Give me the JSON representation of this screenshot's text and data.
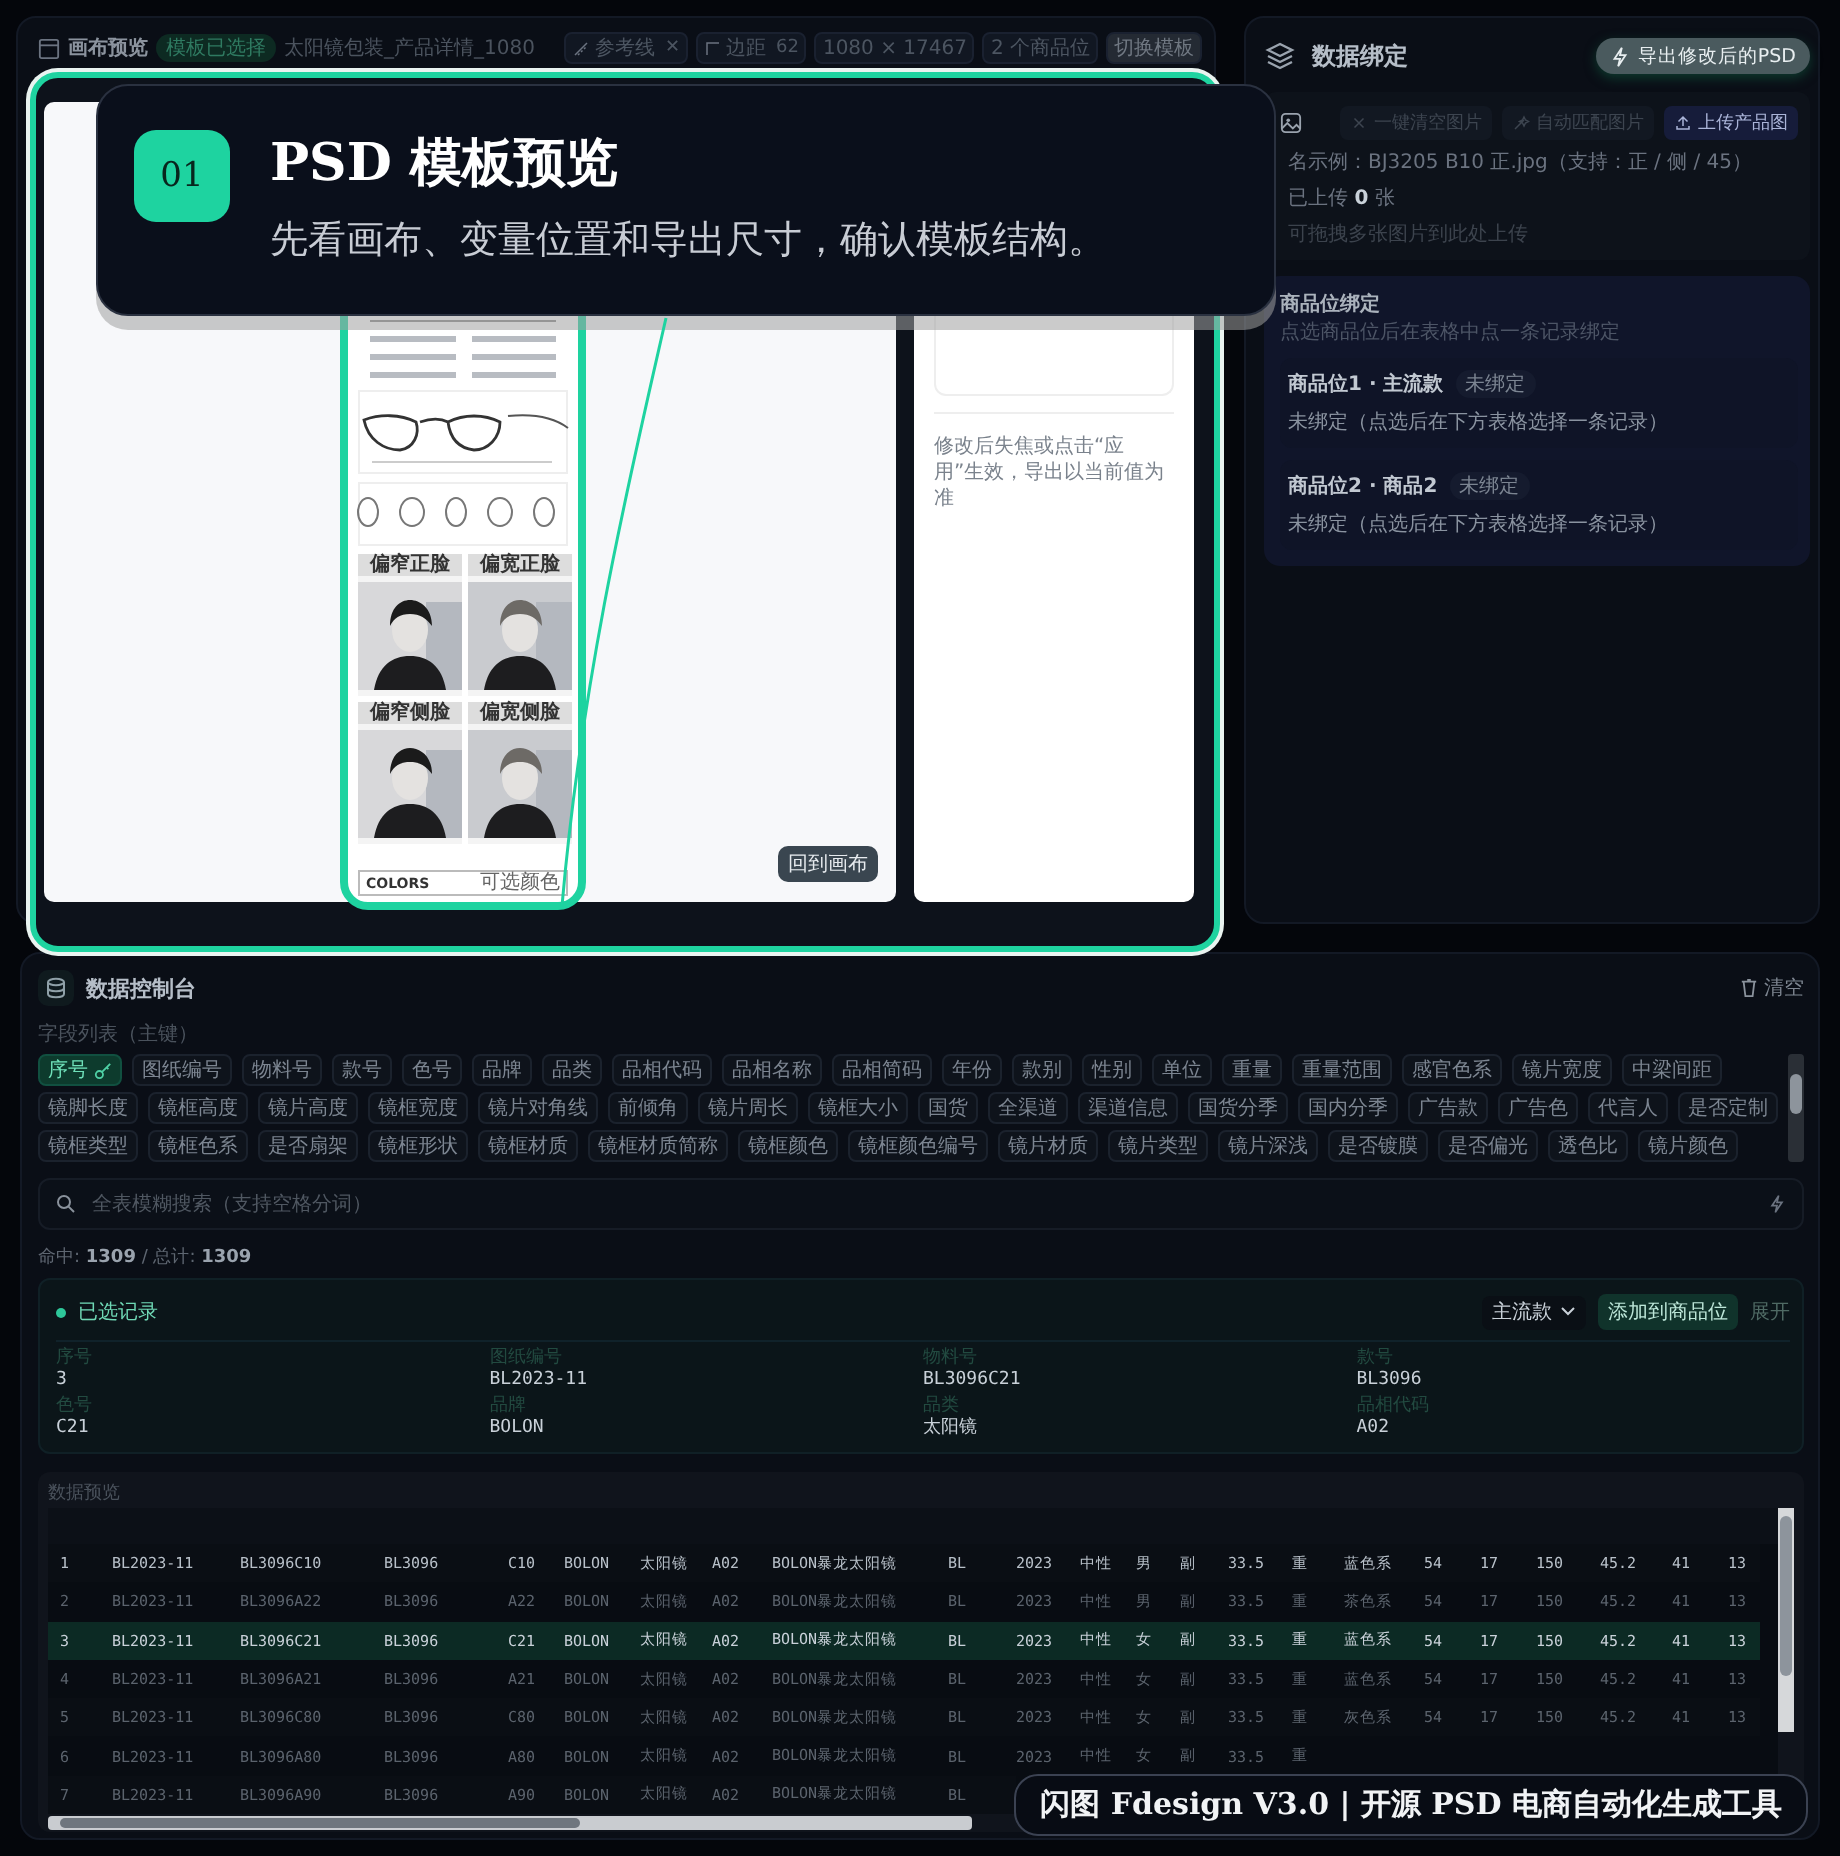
{
  "canvas": {
    "title": "画布预览",
    "status_badge": "模板已选择",
    "template_name": "太阳镜包装_产品详情_1080",
    "tools": [
      {
        "kind": "guides",
        "label": "参考线",
        "value": "✕"
      },
      {
        "kind": "margin",
        "label": "边距",
        "value": "62"
      },
      {
        "kind": "info",
        "label": "1080 × 17467"
      },
      {
        "kind": "info",
        "label": "2 个商品位"
      }
    ],
    "switch_button": "切换模板",
    "mockup": {
      "photo_labels": [
        "偏窄正脸",
        "偏宽正脸",
        "偏窄侧脸",
        "偏宽侧脸"
      ],
      "footer_title": "COLORS",
      "footer_note": "可选颜色"
    },
    "back_button": "回到画布",
    "side_note": "修改后失焦或点击“应用”生效，导出以当前值为准"
  },
  "callout": {
    "step": "01",
    "title": "PSD 模板预览",
    "text": "先看画布、变量位置和导出尺寸，确认模板结构。"
  },
  "binding": {
    "title": "数据绑定",
    "export_button": "导出修改后的PSD",
    "upload": {
      "buttons": [
        {
          "kind": "clear",
          "label": "一键清空图片",
          "disabled": true
        },
        {
          "kind": "match",
          "label": "自动匹配图片",
          "disabled": true
        },
        {
          "kind": "upload",
          "label": "上传产品图",
          "disabled": false
        }
      ],
      "naming_hint": "名示例：BJ3205 B10 正.jpg（支持：正 / 侧 / 45）",
      "uploaded": "已上传 **0** 张",
      "drop_hint": "可拖拽多张图片到此处上传"
    },
    "slots_title": "商品位绑定",
    "slots_subtitle": "点选商品位后在表格中点一条记录绑定",
    "slots": [
      {
        "name": "商品位1 · 主流款",
        "status": "未绑定",
        "detail": "未绑定（点选后在下方表格选择一条记录）"
      },
      {
        "name": "商品位2 · 商品2",
        "status": "未绑定",
        "detail": "未绑定（点选后在下方表格选择一条记录）"
      }
    ]
  },
  "console": {
    "title": "数据控制台",
    "clear_button": "清空",
    "fields_label": "字段列表（主键）",
    "field_rows": [
      [
        {
          "label": "序号",
          "selected": true
        },
        {
          "label": "图纸编号",
          "selected": false
        },
        {
          "label": "物料号",
          "selected": false
        },
        {
          "label": "款号",
          "selected": false
        },
        {
          "label": "色号",
          "selected": false
        },
        {
          "label": "品牌",
          "selected": false
        },
        {
          "label": "品类",
          "selected": false
        },
        {
          "label": "品相代码",
          "selected": false
        },
        {
          "label": "品相名称",
          "selected": false
        },
        {
          "label": "品相简码",
          "selected": false
        },
        {
          "label": "年份",
          "selected": false
        },
        {
          "label": "款别",
          "selected": false
        },
        {
          "label": "性别",
          "selected": false
        },
        {
          "label": "单位",
          "selected": false
        },
        {
          "label": "重量",
          "selected": false
        },
        {
          "label": "重量范围",
          "selected": false
        },
        {
          "label": "感官色系",
          "selected": false
        },
        {
          "label": "镜片宽度",
          "selected": false
        },
        {
          "label": "中梁间距",
          "selected": false
        }
      ],
      [
        {
          "label": "镜脚长度",
          "selected": false
        },
        {
          "label": "镜框高度",
          "selected": false
        },
        {
          "label": "镜片高度",
          "selected": false
        },
        {
          "label": "镜框宽度",
          "selected": false
        },
        {
          "label": "镜片对角线",
          "selected": false
        },
        {
          "label": "前倾角",
          "selected": false
        },
        {
          "label": "镜片周长",
          "selected": false
        },
        {
          "label": "镜框大小",
          "selected": false
        },
        {
          "label": "国货",
          "selected": false
        },
        {
          "label": "全渠道",
          "selected": false
        },
        {
          "label": "渠道信息",
          "selected": false
        },
        {
          "label": "国货分季",
          "selected": false
        },
        {
          "label": "国内分季",
          "selected": false
        },
        {
          "label": "广告款",
          "selected": false
        },
        {
          "label": "广告色",
          "selected": false
        },
        {
          "label": "代言人",
          "selected": false
        },
        {
          "label": "是否定制",
          "selected": false
        }
      ],
      [
        {
          "label": "镜框类型",
          "selected": false
        },
        {
          "label": "镜框色系",
          "selected": false
        },
        {
          "label": "是否扇架",
          "selected": false
        },
        {
          "label": "镜框形状",
          "selected": false
        },
        {
          "label": "镜框材质",
          "selected": false
        },
        {
          "label": "镜框材质简称",
          "selected": false
        },
        {
          "label": "镜框颜色",
          "selected": false
        },
        {
          "label": "镜框颜色编号",
          "selected": false
        },
        {
          "label": "镜片材质",
          "selected": false
        },
        {
          "label": "镜片类型",
          "selected": false
        },
        {
          "label": "镜片深浅",
          "selected": false
        },
        {
          "label": "是否镀膜",
          "selected": false
        },
        {
          "label": "是否偏光",
          "selected": false
        },
        {
          "label": "透色比",
          "selected": false
        },
        {
          "label": "镜片颜色",
          "selected": false
        }
      ]
    ],
    "search": {
      "placeholder": "全表模糊搜索（支持空格分词）"
    },
    "hit_count": "命中: **1309** / 总计: **1309**",
    "selected_record": {
      "title": "已选记录",
      "slot_select": "主流款",
      "add_button": "添加到商品位",
      "expand_link": "展开",
      "fields": [
        {
          "label": "序号",
          "value": "3"
        },
        {
          "label": "图纸编号",
          "value": "BL2023-11"
        },
        {
          "label": "物料号",
          "value": "BL3096C21"
        },
        {
          "label": "款号",
          "value": "BL3096"
        },
        {
          "label": "色号",
          "value": "C21"
        },
        {
          "label": "品牌",
          "value": "BOLON"
        },
        {
          "label": "品类",
          "value": "太阳镜"
        },
        {
          "label": "品相代码",
          "value": "A02"
        }
      ]
    },
    "preview": {
      "title": "数据预览",
      "rows": [
        {
          "selected": false,
          "cells": [
            "1",
            "BL2023-11",
            "BL3096C10",
            "BL3096",
            "C10",
            "BOLON",
            "太阳镜",
            "A02",
            "BOLON暴龙太阳镜",
            "BL",
            "2023",
            "中性",
            "男",
            "副",
            "33.5",
            "重",
            "蓝色系",
            "54",
            "17",
            "150",
            "45.2",
            "41",
            "13"
          ]
        },
        {
          "selected": false,
          "cells": [
            "2",
            "BL2023-11",
            "BL3096A22",
            "BL3096",
            "A22",
            "BOLON",
            "太阳镜",
            "A02",
            "BOLON暴龙太阳镜",
            "BL",
            "2023",
            "中性",
            "男",
            "副",
            "33.5",
            "重",
            "茶色系",
            "54",
            "17",
            "150",
            "45.2",
            "41",
            "13"
          ]
        },
        {
          "selected": true,
          "cells": [
            "3",
            "BL2023-11",
            "BL3096C21",
            "BL3096",
            "C21",
            "BOLON",
            "太阳镜",
            "A02",
            "BOLON暴龙太阳镜",
            "BL",
            "2023",
            "中性",
            "女",
            "副",
            "33.5",
            "重",
            "蓝色系",
            "54",
            "17",
            "150",
            "45.2",
            "41",
            "13"
          ]
        },
        {
          "selected": false,
          "cells": [
            "4",
            "BL2023-11",
            "BL3096A21",
            "BL3096",
            "A21",
            "BOLON",
            "太阳镜",
            "A02",
            "BOLON暴龙太阳镜",
            "BL",
            "2023",
            "中性",
            "女",
            "副",
            "33.5",
            "重",
            "蓝色系",
            "54",
            "17",
            "150",
            "45.2",
            "41",
            "13"
          ]
        },
        {
          "selected": false,
          "cells": [
            "5",
            "BL2023-11",
            "BL3096C80",
            "BL3096",
            "C80",
            "BOLON",
            "太阳镜",
            "A02",
            "BOLON暴龙太阳镜",
            "BL",
            "2023",
            "中性",
            "女",
            "副",
            "33.5",
            "重",
            "灰色系",
            "54",
            "17",
            "150",
            "45.2",
            "41",
            "13"
          ]
        },
        {
          "selected": false,
          "cells": [
            "6",
            "BL2023-11",
            "BL3096A80",
            "BL3096",
            "A80",
            "BOLON",
            "太阳镜",
            "A02",
            "BOLON暴龙太阳镜",
            "BL",
            "2023",
            "中性",
            "女",
            "副",
            "33.5",
            "重"
          ]
        },
        {
          "selected": false,
          "cells": [
            "7",
            "BL2023-11",
            "BL3096A90",
            "BL3096",
            "A90",
            "BOLON",
            "太阳镜",
            "A02",
            "BOLON暴龙太阳镜",
            "BL"
          ]
        }
      ]
    }
  },
  "caption": "闪图 Fdesign V3.0 | 开源 PSD 电商自动化生成工具"
}
